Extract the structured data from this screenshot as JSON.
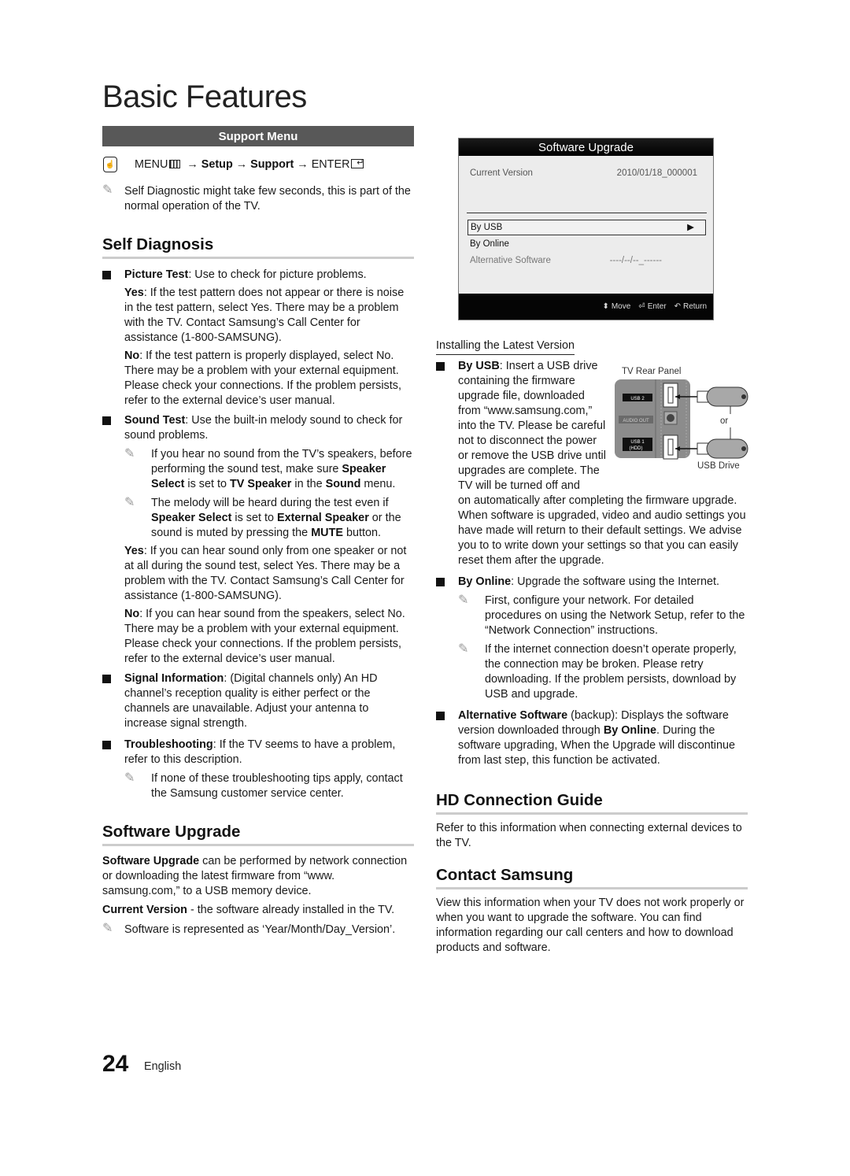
{
  "page": {
    "title": "Basic Features",
    "page_number": "24",
    "language": "English"
  },
  "support_menu": {
    "heading": "Support Menu",
    "menu_path": {
      "menu": "MENU",
      "arrow": "→",
      "setup": "Setup",
      "support": "Support",
      "enter": "ENTER"
    },
    "note": "Self Diagnostic might take few seconds, this is part of the normal operation of the TV."
  },
  "self_diagnosis": {
    "heading": "Self Diagnosis",
    "picture_test": {
      "label": "Picture Test",
      "text": ": Use to check for picture problems.",
      "yes_label": "Yes",
      "yes_text": ": If the test pattern does not appear or there is noise in the test pattern, select Yes. There may be a problem with the TV. Contact Samsung’s Call Center for assistance (1-800-SAMSUNG).",
      "no_label": "No",
      "no_text": ": If the test pattern is properly displayed, select No. There may be a problem with your external equipment. Please check your connections. If the problem persists, refer to the external device’s user manual."
    },
    "sound_test": {
      "label": "Sound Test",
      "text": ": Use the built-in melody sound to check for sound problems.",
      "note1": {
        "t1": "If you hear no sound from the TV’s speakers, before performing the sound test, make sure ",
        "b1": "Speaker Select",
        "t2": " is set to ",
        "b2": "TV Speaker",
        "t3": " in the ",
        "b3": "Sound",
        "t4": " menu."
      },
      "note2": {
        "t1": "The melody will be heard during the test even if ",
        "b1": "Speaker Select",
        "t2": " is set to ",
        "b2": "External Speaker",
        "t3": " or the sound is muted by pressing the ",
        "b3": "MUTE",
        "t4": " button."
      },
      "yes_label": "Yes",
      "yes_text": ": If you can hear sound only from one speaker or not at all during the sound test, select Yes. There may be a problem with the TV. Contact Samsung’s Call Center for assistance (1-800-SAMSUNG).",
      "no_label": "No",
      "no_text": ": If you can hear sound from the speakers, select No. There may be a problem with your external equipment. Please check your connections. If the problem persists, refer to the external device’s user manual."
    },
    "signal_information": {
      "label": "Signal Information",
      "text": ": (Digital channels only) An HD channel’s reception quality is either perfect or the channels are unavailable. Adjust your antenna to increase signal strength."
    },
    "troubleshooting": {
      "label": "Troubleshooting",
      "text": ": If the TV seems to have a problem, refer to this description.",
      "note": "If none of these troubleshooting tips apply, contact the Samsung customer service center."
    }
  },
  "software_upgrade": {
    "heading": "Software Upgrade",
    "intro_bold": "Software Upgrade",
    "intro_text": " can be performed by network connection or downloading the latest firmware from “www. samsung.com,” to a USB memory device.",
    "current_bold": "Current Version",
    "current_text": " - the software already installed in the TV.",
    "note": "Software is represented as ‘Year/Month/Day_Version’."
  },
  "osd": {
    "title": "Software Upgrade",
    "current_version_label": "Current Version",
    "current_version_value": "2010/01/18_000001",
    "items": [
      {
        "label": "By USB",
        "value": "▶",
        "state": "selected"
      },
      {
        "label": "By Online",
        "value": "",
        "state": "normal"
      },
      {
        "label": "Alternative Software",
        "value": "----/--/--_------",
        "state": "disabled"
      }
    ],
    "footer": {
      "move_icon": "⬍",
      "move": "Move",
      "enter_icon": "⏎",
      "enter": "Enter",
      "return_icon": "↶",
      "return": "Return"
    }
  },
  "installing": {
    "heading": "Installing the Latest Version",
    "by_usb": {
      "label": "By USB",
      "text_narrow": ": Insert a USB drive containing the firmware upgrade file, downloaded from “www.samsung.com,” into the TV. Please be careful not to disconnect the power or remove the USB drive until upgrades are complete. The TV will be turned off and",
      "text_wide": "on automatically after completing the firmware upgrade. When software is upgraded, video and audio settings you have made will return to their default settings. We advise you to to write down your settings so that you can easily reset them after the upgrade."
    },
    "by_online": {
      "label": "By Online",
      "text": ": Upgrade the software using the Internet.",
      "note1": "First, configure your network. For detailed procedures on using the Network Setup, refer to the “Network Connection” instructions.",
      "note2": "If the internet connection doesn’t operate properly, the connection may be broken. Please retry downloading. If the problem persists, download by USB and upgrade."
    },
    "alternative": {
      "label": "Alternative Software",
      "t1": " (backup): Displays the software version downloaded through ",
      "b1": "By Online",
      "t2": ". During the software upgrading, When the Upgrade will discontinue from last step, this function be activated."
    }
  },
  "diagram": {
    "title": "TV Rear Panel",
    "usb2": "USB 2 ⭠",
    "audio_out": "AUDIO OUT",
    "usb1": "USB 1 ⭠",
    "usb1_sub": "(HDD)",
    "or": "or",
    "usb_drive": "USB Drive"
  },
  "hd_connection": {
    "heading": "HD Connection Guide",
    "text": "Refer to this information when connecting external devices to the TV."
  },
  "contact": {
    "heading": "Contact Samsung",
    "text": "View this information when your TV does not work properly or when you want to upgrade the software. You can find information regarding our call centers and how to download products and software."
  },
  "icons": {
    "pencil": "✎",
    "hand": "☝"
  }
}
